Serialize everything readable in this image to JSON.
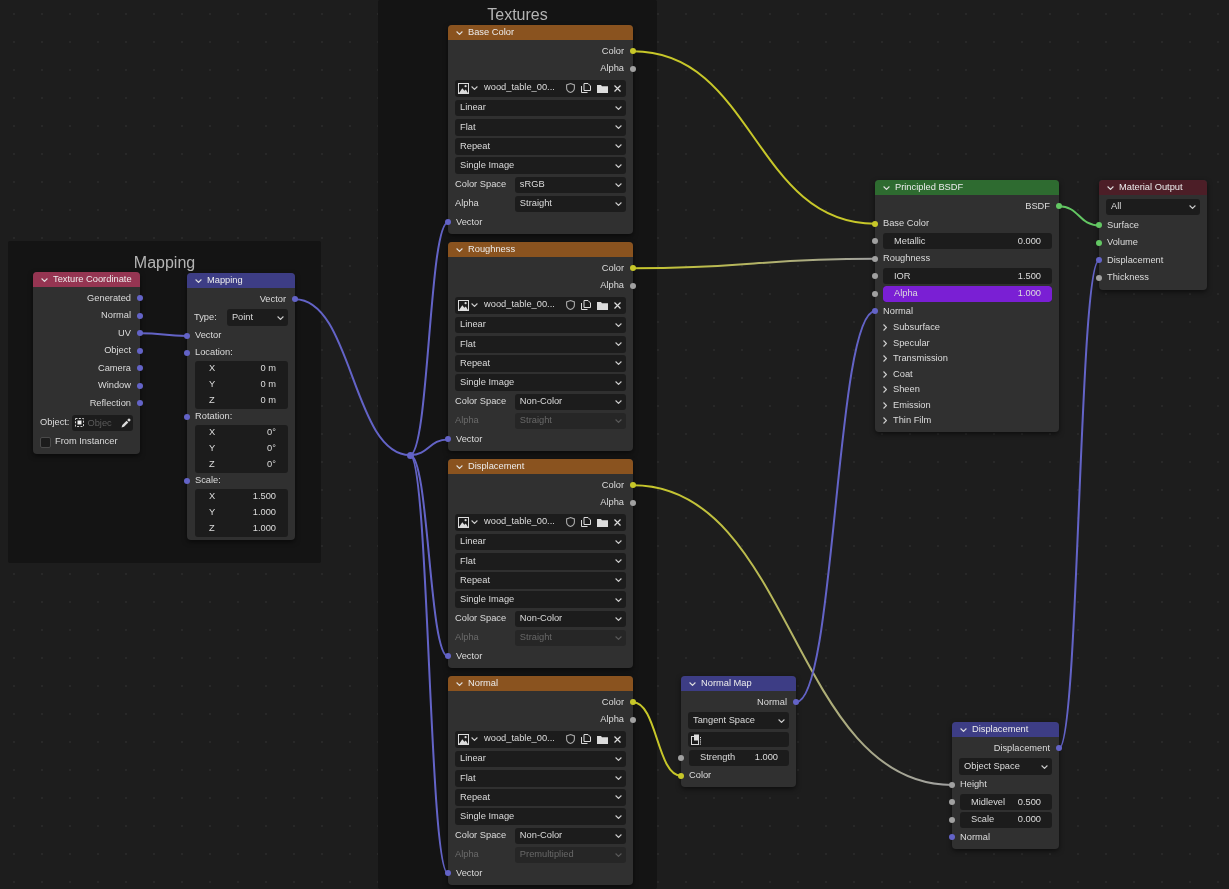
{
  "frames": [
    {
      "label": "Mapping"
    },
    {
      "label": "Textures"
    }
  ],
  "nodes": [
    {
      "kind": "node",
      "title": "Texture Coordinate",
      "color": "#953552",
      "expanded": true,
      "rows": [
        {
          "kind": "output",
          "label": "Generated",
          "socket": {
            "color": "#6363c7"
          }
        },
        {
          "kind": "output",
          "label": "Normal",
          "socket": {
            "color": "#6363c7"
          }
        },
        {
          "kind": "output",
          "label": "UV",
          "socket": {
            "color": "#6363c7"
          }
        },
        {
          "kind": "output",
          "label": "Object",
          "socket": {
            "color": "#6363c7"
          }
        },
        {
          "kind": "output",
          "label": "Camera",
          "socket": {
            "color": "#6363c7"
          }
        },
        {
          "kind": "output",
          "label": "Window",
          "socket": {
            "color": "#6363c7"
          }
        },
        {
          "kind": "output",
          "label": "Reflection",
          "socket": {
            "color": "#6363c7"
          }
        },
        {
          "kind": "object",
          "label": "Object:",
          "placeholder": "Objec"
        },
        {
          "kind": "checkbox",
          "label": "From Instancer",
          "checked": false
        }
      ]
    },
    {
      "kind": "node",
      "title": "Mapping",
      "color": "#3d3d85",
      "expanded": true,
      "rows": [
        {
          "kind": "output",
          "label": "Vector",
          "socket": {
            "color": "#6363c7"
          }
        },
        {
          "kind": "dropdown",
          "label": "Type:",
          "value": "Point",
          "disabled": false
        },
        {
          "kind": "input",
          "label": "Vector",
          "socket": {
            "color": "#6363c7"
          }
        },
        {
          "kind": "vector",
          "label": "Location:",
          "socket": {
            "color": "#6363c7"
          },
          "fields": [
            {
              "axis": "X",
              "value": "0 m"
            },
            {
              "axis": "Y",
              "value": "0 m"
            },
            {
              "axis": "Z",
              "value": "0 m"
            }
          ]
        },
        {
          "kind": "vector",
          "label": "Rotation:",
          "socket": {
            "color": "#6363c7"
          },
          "fields": [
            {
              "axis": "X",
              "value": "0°"
            },
            {
              "axis": "Y",
              "value": "0°"
            },
            {
              "axis": "Z",
              "value": "0°"
            }
          ]
        },
        {
          "kind": "vector",
          "label": "Scale:",
          "socket": {
            "color": "#6363c7"
          },
          "fields": [
            {
              "axis": "X",
              "value": "1.500"
            },
            {
              "axis": "Y",
              "value": "1.000"
            },
            {
              "axis": "Z",
              "value": "1.000"
            }
          ]
        }
      ]
    },
    {
      "kind": "node",
      "title": "Base Color",
      "color": "#8a531f",
      "expanded": true,
      "rows": [
        {
          "kind": "output",
          "label": "Color",
          "socket": {
            "color": "#c7c729"
          }
        },
        {
          "kind": "output",
          "label": "Alpha",
          "socket": {
            "color": "#a1a1a1"
          }
        },
        {
          "kind": "image",
          "value": "wood_table_00..."
        },
        {
          "kind": "dropdown",
          "value": "Linear",
          "disabled": false
        },
        {
          "kind": "dropdown",
          "value": "Flat",
          "disabled": false
        },
        {
          "kind": "dropdown",
          "value": "Repeat",
          "disabled": false
        },
        {
          "kind": "dropdown",
          "value": "Single Image",
          "disabled": false
        },
        {
          "kind": "dropdown",
          "label": "Color Space",
          "value": "sRGB",
          "disabled": false
        },
        {
          "kind": "dropdown",
          "label": "Alpha",
          "value": "Straight",
          "disabled": false
        },
        {
          "kind": "input",
          "label": "Vector",
          "socket": {
            "color": "#6363c7"
          }
        }
      ]
    },
    {
      "kind": "node",
      "title": "Roughness",
      "color": "#8a531f",
      "expanded": true,
      "rows": [
        {
          "kind": "output",
          "label": "Color",
          "socket": {
            "color": "#c7c729"
          }
        },
        {
          "kind": "output",
          "label": "Alpha",
          "socket": {
            "color": "#a1a1a1"
          }
        },
        {
          "kind": "image",
          "value": "wood_table_00..."
        },
        {
          "kind": "dropdown",
          "value": "Linear",
          "disabled": false
        },
        {
          "kind": "dropdown",
          "value": "Flat",
          "disabled": false
        },
        {
          "kind": "dropdown",
          "value": "Repeat",
          "disabled": false
        },
        {
          "kind": "dropdown",
          "value": "Single Image",
          "disabled": false
        },
        {
          "kind": "dropdown",
          "label": "Color Space",
          "value": "Non-Color",
          "disabled": false
        },
        {
          "kind": "dropdown",
          "label": "Alpha",
          "value": "Straight",
          "disabled": true
        },
        {
          "kind": "input",
          "label": "Vector",
          "socket": {
            "color": "#6363c7"
          }
        }
      ]
    },
    {
      "kind": "node",
      "title": "Displacement",
      "color": "#8a531f",
      "expanded": true,
      "rows": [
        {
          "kind": "output",
          "label": "Color",
          "socket": {
            "color": "#c7c729"
          }
        },
        {
          "kind": "output",
          "label": "Alpha",
          "socket": {
            "color": "#a1a1a1"
          }
        },
        {
          "kind": "image",
          "value": "wood_table_00..."
        },
        {
          "kind": "dropdown",
          "value": "Linear",
          "disabled": false
        },
        {
          "kind": "dropdown",
          "value": "Flat",
          "disabled": false
        },
        {
          "kind": "dropdown",
          "value": "Repeat",
          "disabled": false
        },
        {
          "kind": "dropdown",
          "value": "Single Image",
          "disabled": false
        },
        {
          "kind": "dropdown",
          "label": "Color Space",
          "value": "Non-Color",
          "disabled": false
        },
        {
          "kind": "dropdown",
          "label": "Alpha",
          "value": "Straight",
          "disabled": true
        },
        {
          "kind": "input",
          "label": "Vector",
          "socket": {
            "color": "#6363c7"
          }
        }
      ]
    },
    {
      "kind": "node",
      "title": "Normal",
      "color": "#8a531f",
      "expanded": true,
      "rows": [
        {
          "kind": "output",
          "label": "Color",
          "socket": {
            "color": "#c7c729"
          }
        },
        {
          "kind": "output",
          "label": "Alpha",
          "socket": {
            "color": "#a1a1a1"
          }
        },
        {
          "kind": "image",
          "value": "wood_table_00..."
        },
        {
          "kind": "dropdown",
          "value": "Linear",
          "disabled": false
        },
        {
          "kind": "dropdown",
          "value": "Flat",
          "disabled": false
        },
        {
          "kind": "dropdown",
          "value": "Repeat",
          "disabled": false
        },
        {
          "kind": "dropdown",
          "value": "Single Image",
          "disabled": false
        },
        {
          "kind": "dropdown",
          "label": "Color Space",
          "value": "Non-Color",
          "disabled": false
        },
        {
          "kind": "dropdown",
          "label": "Alpha",
          "value": "Premultiplied",
          "disabled": true
        },
        {
          "kind": "input",
          "label": "Vector",
          "socket": {
            "color": "#6363c7"
          }
        }
      ]
    },
    {
      "kind": "node",
      "title": "Normal Map",
      "color": "#3d3d85",
      "expanded": true,
      "rows": [
        {
          "kind": "output",
          "label": "Normal",
          "socket": {
            "color": "#6363c7"
          }
        },
        {
          "kind": "dropdown",
          "value": "Tangent Space",
          "disabled": false
        },
        {
          "kind": "uvmap"
        },
        {
          "kind": "value",
          "label": "Strength",
          "value": "1.000",
          "socket": {
            "color": "#a1a1a1"
          }
        },
        {
          "kind": "input",
          "label": "Color",
          "socket": {
            "color": "#c7c729"
          }
        }
      ]
    },
    {
      "kind": "node",
      "title": "Principled BSDF",
      "color": "#2e6b30",
      "expanded": true,
      "rows": [
        {
          "kind": "output",
          "label": "BSDF",
          "socket": {
            "color": "#63c763"
          }
        },
        {
          "kind": "input",
          "label": "Base Color",
          "socket": {
            "color": "#c7c729"
          }
        },
        {
          "kind": "value",
          "label": "Metallic",
          "value": "0.000",
          "socket": {
            "color": "#a1a1a1"
          }
        },
        {
          "kind": "input",
          "label": "Roughness",
          "socket": {
            "color": "#a1a1a1"
          }
        },
        {
          "kind": "value",
          "label": "IOR",
          "value": "1.500",
          "socket": {
            "color": "#a1a1a1"
          }
        },
        {
          "kind": "value",
          "label": "Alpha",
          "value": "1.000",
          "socket": {
            "color": "#a1a1a1"
          },
          "level": 1
        },
        {
          "kind": "input",
          "label": "Normal",
          "socket": {
            "color": "#6363c7"
          }
        },
        {
          "kind": "panel",
          "label": "Subsurface",
          "expanded": false
        },
        {
          "kind": "panel",
          "label": "Specular",
          "expanded": false
        },
        {
          "kind": "panel",
          "label": "Transmission",
          "expanded": false
        },
        {
          "kind": "panel",
          "label": "Coat",
          "expanded": false
        },
        {
          "kind": "panel",
          "label": "Sheen",
          "expanded": false
        },
        {
          "kind": "panel",
          "label": "Emission",
          "expanded": false
        },
        {
          "kind": "panel",
          "label": "Thin Film",
          "expanded": false
        }
      ]
    },
    {
      "kind": "node",
      "title": "Material Output",
      "color": "#4c1e27",
      "expanded": true,
      "rows": [
        {
          "kind": "dropdown",
          "value": "All",
          "disabled": false
        },
        {
          "kind": "input",
          "label": "Surface",
          "socket": {
            "color": "#63c763"
          }
        },
        {
          "kind": "input",
          "label": "Volume",
          "socket": {
            "color": "#63c763"
          }
        },
        {
          "kind": "input",
          "label": "Displacement",
          "socket": {
            "color": "#6363c7"
          }
        },
        {
          "kind": "input",
          "label": "Thickness",
          "socket": {
            "color": "#a1a1a1"
          }
        }
      ]
    },
    {
      "kind": "node",
      "title": "Displacement",
      "color": "#3d3d85",
      "expanded": true,
      "rows": [
        {
          "kind": "output",
          "label": "Displacement",
          "socket": {
            "color": "#6363c7"
          }
        },
        {
          "kind": "dropdown",
          "value": "Object Space",
          "disabled": false
        },
        {
          "kind": "input",
          "label": "Height",
          "socket": {
            "color": "#a1a1a1"
          }
        },
        {
          "kind": "value",
          "label": "Midlevel",
          "value": "0.500",
          "socket": {
            "color": "#a1a1a1"
          }
        },
        {
          "kind": "value",
          "label": "Scale",
          "value": "0.000",
          "socket": {
            "color": "#a1a1a1"
          }
        },
        {
          "kind": "input",
          "label": "Normal",
          "socket": {
            "color": "#6363c7"
          }
        }
      ]
    },
    {
      "kind": "reroute",
      "socket": {
        "color": "#6363c7"
      }
    }
  ]
}
